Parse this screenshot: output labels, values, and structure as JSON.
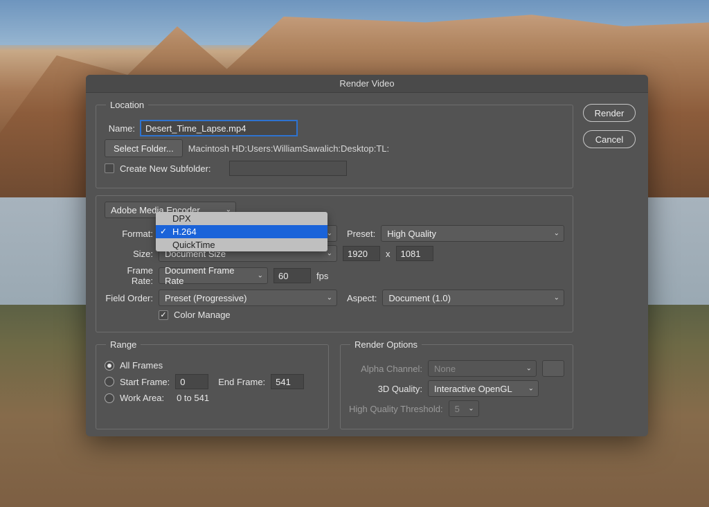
{
  "dialog": {
    "title": "Render Video",
    "buttons": {
      "render": "Render",
      "cancel": "Cancel"
    }
  },
  "location": {
    "legend": "Location",
    "name_label": "Name:",
    "name_value": "Desert_Time_Lapse.mp4",
    "select_folder": "Select Folder...",
    "path": "Macintosh HD:Users:WilliamSawalich:Desktop:TL:",
    "create_subfolder_label": "Create New Subfolder:",
    "create_subfolder_checked": false
  },
  "encoder": {
    "engine": "Adobe Media Encoder",
    "format_label": "Format:",
    "format_dropdown": {
      "options": [
        "DPX",
        "H.264",
        "QuickTime"
      ],
      "selected": "H.264"
    },
    "preset_label": "Preset:",
    "preset_value": "High Quality",
    "size_label": "Size:",
    "size_mode": "Document Size",
    "width": "1920",
    "x": "x",
    "height": "1081",
    "framerate_label": "Frame Rate:",
    "framerate_mode": "Document Frame Rate",
    "framerate_value": "60",
    "fps": "fps",
    "fieldorder_label": "Field Order:",
    "fieldorder_value": "Preset (Progressive)",
    "aspect_label": "Aspect:",
    "aspect_value": "Document (1.0)",
    "color_manage_label": "Color Manage",
    "color_manage_checked": true
  },
  "range": {
    "legend": "Range",
    "all_frames": "All Frames",
    "start_frame_label": "Start Frame:",
    "start_frame_value": "0",
    "end_frame_label": "End Frame:",
    "end_frame_value": "541",
    "work_area_label": "Work Area:",
    "work_area_value": "0 to 541"
  },
  "render_options": {
    "legend": "Render Options",
    "alpha_label": "Alpha Channel:",
    "alpha_value": "None",
    "quality_label": "3D Quality:",
    "quality_value": "Interactive OpenGL",
    "threshold_label": "High Quality Threshold:",
    "threshold_value": "5"
  }
}
